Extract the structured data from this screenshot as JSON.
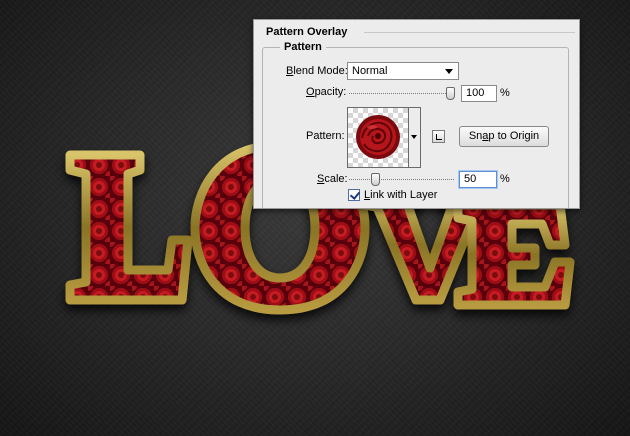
{
  "artwork": {
    "text": "LOVE",
    "colors": {
      "gold": "#8a7426",
      "gold_highlight": "#d9c46a",
      "fill": "#8c0d12",
      "rose": "#c41b20"
    }
  },
  "dialog": {
    "title": "Pattern Overlay",
    "group_title": "Pattern",
    "blend_mode": {
      "label_prefix": "B",
      "label_rest": "lend Mode:",
      "value": "Normal"
    },
    "opacity": {
      "label_prefix": "O",
      "label_rest": "pacity:",
      "value": "100",
      "unit": "%",
      "level": 1.0
    },
    "pattern": {
      "label": "Pattern:",
      "swatch": "rose-pattern",
      "snap_button": {
        "prefix": "Sn",
        "accel": "a",
        "rest": "p to Origin"
      }
    },
    "scale": {
      "label_prefix": "S",
      "label_rest": "cale:",
      "value": "50",
      "unit": "%",
      "level": 0.25
    },
    "link": {
      "checked": true,
      "prefix": "L",
      "rest": "ink with Layer"
    }
  }
}
